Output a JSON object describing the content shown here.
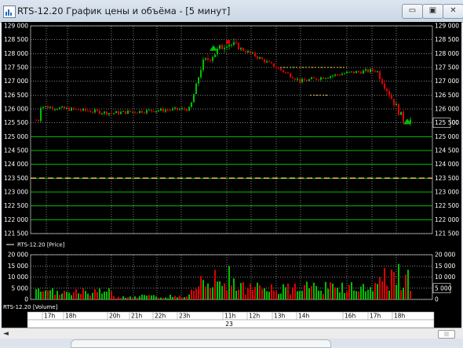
{
  "window": {
    "title": "RTS-12.20 График цены и объёма - [5 минут]",
    "buttons": {
      "minimize": "▭",
      "maximize": "▣",
      "close": "✕"
    }
  },
  "chart_data": [
    {
      "type": "line",
      "chart_kind": "candlestick",
      "series": [
        {
          "name": "RTS-12.20 [Price]"
        }
      ],
      "ylim": [
        121500,
        129000
      ],
      "y_ticks": [
        "129 000",
        "128 500",
        "128 000",
        "127 500",
        "127 000",
        "126 500",
        "126 000",
        "125 500",
        "125 000",
        "124 500",
        "124 000",
        "123 500",
        "123 000",
        "122 500",
        "122 000",
        "121 500"
      ],
      "y_tick_values": [
        129000,
        128500,
        128000,
        127500,
        127000,
        126500,
        126000,
        125500,
        125000,
        124500,
        124000,
        123500,
        123000,
        122500,
        122000,
        121500
      ],
      "current_price_label": "125 500",
      "key_points": [
        {
          "x": "17h",
          "y": 126100
        },
        {
          "x": "18h",
          "y": 126000
        },
        {
          "x": "20h",
          "y": 125850
        },
        {
          "x": "21h",
          "y": 125900
        },
        {
          "x": "22h",
          "y": 125950
        },
        {
          "x": "23h",
          "y": 126000
        },
        {
          "x": "23h",
          "y": 127600
        },
        {
          "x": "11h",
          "y": 128400
        },
        {
          "x": "12h",
          "y": 128000
        },
        {
          "x": "13h",
          "y": 127500
        },
        {
          "x": "14h",
          "y": 127000
        },
        {
          "x": "16h",
          "y": 127300
        },
        {
          "x": "17h",
          "y": 127400
        },
        {
          "x": "18h",
          "y": 125600
        }
      ],
      "horizontal_levels": [
        125000,
        124500,
        124000,
        123500,
        123000,
        122500,
        122000
      ],
      "dashed_levels": [
        123500,
        127500
      ],
      "grid": true
    },
    {
      "type": "bar",
      "series": [
        {
          "name": "RTS-12.20 [Volume]"
        }
      ],
      "ylim": [
        0,
        20000
      ],
      "y_ticks": [
        "20 000",
        "15 000",
        "10 000",
        "5 000",
        "0"
      ],
      "y_tick_values": [
        20000,
        15000,
        10000,
        5000,
        0
      ],
      "current_volume_label": "5 000",
      "grid": true
    }
  ],
  "time_axis": {
    "labels": [
      "17h",
      "18h",
      "20h",
      "21h",
      "22h",
      "23h",
      "11h",
      "12h",
      "13h",
      "14h",
      "16h",
      "17h",
      "18h"
    ],
    "date_label": "23"
  },
  "scrollbar": {
    "left_arrow": "◄",
    "thumb": "|||"
  },
  "colors": {
    "up": "#00c000",
    "down": "#e00000",
    "grid": "#ffffff",
    "level": "#00c000",
    "dashed": "#ffd24a",
    "background": "#000000"
  }
}
